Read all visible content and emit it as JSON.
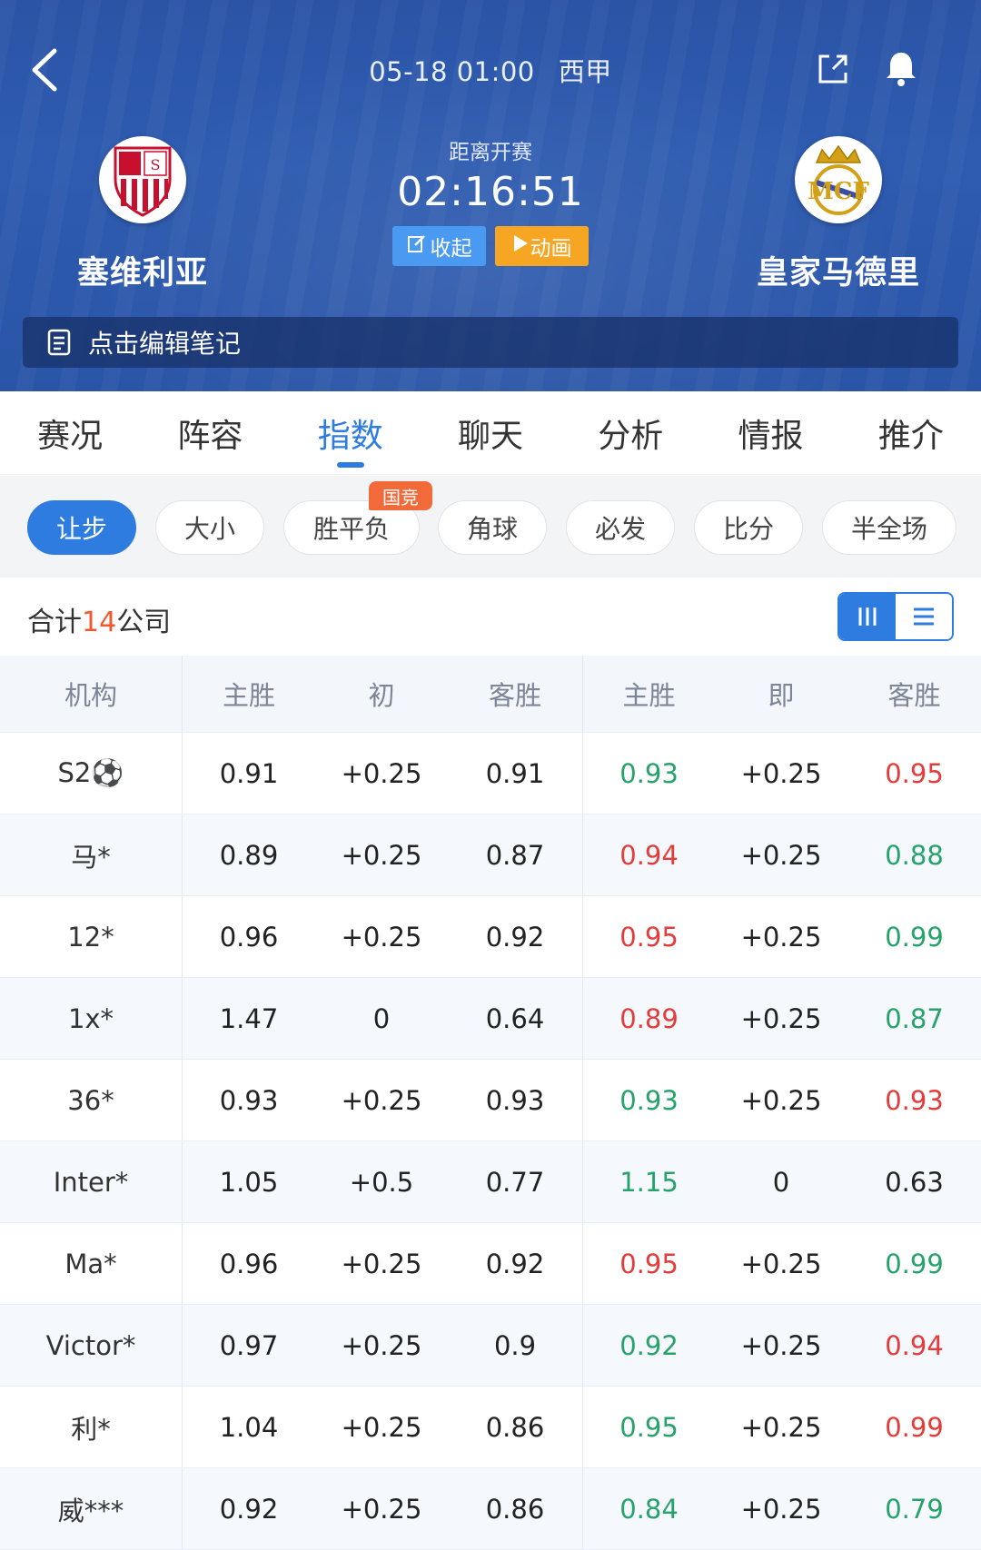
{
  "header": {
    "datetime": "05-18 01:00",
    "league": "西甲",
    "countdown_label": "距离开赛",
    "countdown_time": "02:16:51",
    "collapse_label": "收起",
    "animation_label": "动画",
    "home_team": "塞维利亚",
    "away_team": "皇家马德里",
    "note_label": "点击编辑笔记"
  },
  "main_tabs": [
    "赛况",
    "阵容",
    "指数",
    "聊天",
    "分析",
    "情报",
    "推介"
  ],
  "active_main_tab": "指数",
  "sub_tabs": [
    "让步",
    "大小",
    "胜平负",
    "角球",
    "必发",
    "比分",
    "半全场"
  ],
  "sub_tab_badge": "国竞",
  "summary": {
    "prefix": "合计",
    "count": "14",
    "suffix": "公司"
  },
  "table": {
    "headers": [
      "机构",
      "主胜",
      "初",
      "客胜",
      "主胜",
      "即",
      "客胜"
    ],
    "rows": [
      {
        "company": "S2⚽",
        "init_home": "0.91",
        "init_line": "+0.25",
        "init_away": "0.91",
        "live_home": "0.93",
        "live_line": "+0.25",
        "live_away": "0.95",
        "home_color": "green",
        "away_color": "red"
      },
      {
        "company": "马*",
        "init_home": "0.89",
        "init_line": "+0.25",
        "init_away": "0.87",
        "live_home": "0.94",
        "live_line": "+0.25",
        "live_away": "0.88",
        "home_color": "red",
        "away_color": "green"
      },
      {
        "company": "12*",
        "init_home": "0.96",
        "init_line": "+0.25",
        "init_away": "0.92",
        "live_home": "0.95",
        "live_line": "+0.25",
        "live_away": "0.99",
        "home_color": "red",
        "away_color": "green"
      },
      {
        "company": "1x*",
        "init_home": "1.47",
        "init_line": "0",
        "init_away": "0.64",
        "live_home": "0.89",
        "live_line": "+0.25",
        "live_away": "0.87",
        "home_color": "red",
        "away_color": "green"
      },
      {
        "company": "36*",
        "init_home": "0.93",
        "init_line": "+0.25",
        "init_away": "0.93",
        "live_home": "0.93",
        "live_line": "+0.25",
        "live_away": "0.93",
        "home_color": "green",
        "away_color": "red"
      },
      {
        "company": "Inter*",
        "init_home": "1.05",
        "init_line": "+0.5",
        "init_away": "0.77",
        "live_home": "1.15",
        "live_line": "0",
        "live_away": "0.63",
        "home_color": "green",
        "away_color": "none"
      },
      {
        "company": "Ma*",
        "init_home": "0.96",
        "init_line": "+0.25",
        "init_away": "0.92",
        "live_home": "0.95",
        "live_line": "+0.25",
        "live_away": "0.99",
        "home_color": "red",
        "away_color": "green"
      },
      {
        "company": "Victor*",
        "init_home": "0.97",
        "init_line": "+0.25",
        "init_away": "0.9",
        "live_home": "0.92",
        "live_line": "+0.25",
        "live_away": "0.94",
        "home_color": "green",
        "away_color": "red"
      },
      {
        "company": "利*",
        "init_home": "1.04",
        "init_line": "+0.25",
        "init_away": "0.86",
        "live_home": "0.95",
        "live_line": "+0.25",
        "live_away": "0.99",
        "home_color": "green",
        "away_color": "red"
      },
      {
        "company": "威***",
        "init_home": "0.92",
        "init_line": "+0.25",
        "init_away": "0.86",
        "live_home": "0.84",
        "live_line": "+0.25",
        "live_away": "0.79",
        "home_color": "green",
        "away_color": "green"
      }
    ]
  },
  "colors": {
    "accent": "#2f7ce0",
    "up": "#e43b3b",
    "down": "#26a36a",
    "badge": "#f26a3a",
    "animation": "#f6a623"
  },
  "icons": [
    "back-arrow-icon",
    "share-icon",
    "bell-icon",
    "edit-icon",
    "play-icon",
    "note-icon",
    "column-view-icon",
    "list-view-icon"
  ]
}
